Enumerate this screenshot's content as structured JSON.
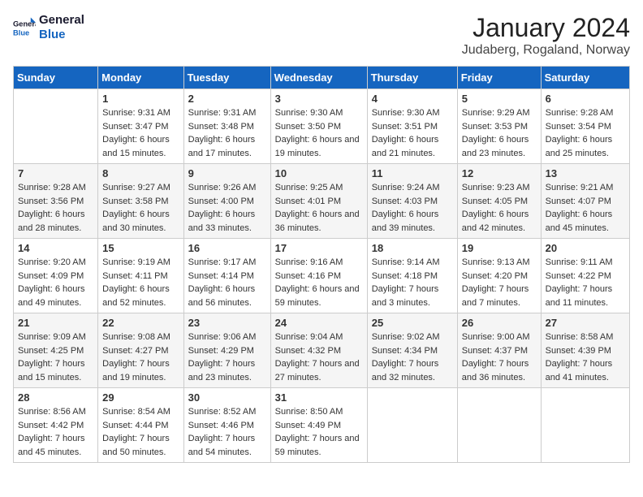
{
  "logo": {
    "line1": "General",
    "line2": "Blue"
  },
  "title": "January 2024",
  "location": "Judaberg, Rogaland, Norway",
  "days_of_week": [
    "Sunday",
    "Monday",
    "Tuesday",
    "Wednesday",
    "Thursday",
    "Friday",
    "Saturday"
  ],
  "weeks": [
    [
      {
        "day": "",
        "sunrise": "",
        "sunset": "",
        "daylight": ""
      },
      {
        "day": "1",
        "sunrise": "Sunrise: 9:31 AM",
        "sunset": "Sunset: 3:47 PM",
        "daylight": "Daylight: 6 hours and 15 minutes."
      },
      {
        "day": "2",
        "sunrise": "Sunrise: 9:31 AM",
        "sunset": "Sunset: 3:48 PM",
        "daylight": "Daylight: 6 hours and 17 minutes."
      },
      {
        "day": "3",
        "sunrise": "Sunrise: 9:30 AM",
        "sunset": "Sunset: 3:50 PM",
        "daylight": "Daylight: 6 hours and 19 minutes."
      },
      {
        "day": "4",
        "sunrise": "Sunrise: 9:30 AM",
        "sunset": "Sunset: 3:51 PM",
        "daylight": "Daylight: 6 hours and 21 minutes."
      },
      {
        "day": "5",
        "sunrise": "Sunrise: 9:29 AM",
        "sunset": "Sunset: 3:53 PM",
        "daylight": "Daylight: 6 hours and 23 minutes."
      },
      {
        "day": "6",
        "sunrise": "Sunrise: 9:28 AM",
        "sunset": "Sunset: 3:54 PM",
        "daylight": "Daylight: 6 hours and 25 minutes."
      }
    ],
    [
      {
        "day": "7",
        "sunrise": "Sunrise: 9:28 AM",
        "sunset": "Sunset: 3:56 PM",
        "daylight": "Daylight: 6 hours and 28 minutes."
      },
      {
        "day": "8",
        "sunrise": "Sunrise: 9:27 AM",
        "sunset": "Sunset: 3:58 PM",
        "daylight": "Daylight: 6 hours and 30 minutes."
      },
      {
        "day": "9",
        "sunrise": "Sunrise: 9:26 AM",
        "sunset": "Sunset: 4:00 PM",
        "daylight": "Daylight: 6 hours and 33 minutes."
      },
      {
        "day": "10",
        "sunrise": "Sunrise: 9:25 AM",
        "sunset": "Sunset: 4:01 PM",
        "daylight": "Daylight: 6 hours and 36 minutes."
      },
      {
        "day": "11",
        "sunrise": "Sunrise: 9:24 AM",
        "sunset": "Sunset: 4:03 PM",
        "daylight": "Daylight: 6 hours and 39 minutes."
      },
      {
        "day": "12",
        "sunrise": "Sunrise: 9:23 AM",
        "sunset": "Sunset: 4:05 PM",
        "daylight": "Daylight: 6 hours and 42 minutes."
      },
      {
        "day": "13",
        "sunrise": "Sunrise: 9:21 AM",
        "sunset": "Sunset: 4:07 PM",
        "daylight": "Daylight: 6 hours and 45 minutes."
      }
    ],
    [
      {
        "day": "14",
        "sunrise": "Sunrise: 9:20 AM",
        "sunset": "Sunset: 4:09 PM",
        "daylight": "Daylight: 6 hours and 49 minutes."
      },
      {
        "day": "15",
        "sunrise": "Sunrise: 9:19 AM",
        "sunset": "Sunset: 4:11 PM",
        "daylight": "Daylight: 6 hours and 52 minutes."
      },
      {
        "day": "16",
        "sunrise": "Sunrise: 9:17 AM",
        "sunset": "Sunset: 4:14 PM",
        "daylight": "Daylight: 6 hours and 56 minutes."
      },
      {
        "day": "17",
        "sunrise": "Sunrise: 9:16 AM",
        "sunset": "Sunset: 4:16 PM",
        "daylight": "Daylight: 6 hours and 59 minutes."
      },
      {
        "day": "18",
        "sunrise": "Sunrise: 9:14 AM",
        "sunset": "Sunset: 4:18 PM",
        "daylight": "Daylight: 7 hours and 3 minutes."
      },
      {
        "day": "19",
        "sunrise": "Sunrise: 9:13 AM",
        "sunset": "Sunset: 4:20 PM",
        "daylight": "Daylight: 7 hours and 7 minutes."
      },
      {
        "day": "20",
        "sunrise": "Sunrise: 9:11 AM",
        "sunset": "Sunset: 4:22 PM",
        "daylight": "Daylight: 7 hours and 11 minutes."
      }
    ],
    [
      {
        "day": "21",
        "sunrise": "Sunrise: 9:09 AM",
        "sunset": "Sunset: 4:25 PM",
        "daylight": "Daylight: 7 hours and 15 minutes."
      },
      {
        "day": "22",
        "sunrise": "Sunrise: 9:08 AM",
        "sunset": "Sunset: 4:27 PM",
        "daylight": "Daylight: 7 hours and 19 minutes."
      },
      {
        "day": "23",
        "sunrise": "Sunrise: 9:06 AM",
        "sunset": "Sunset: 4:29 PM",
        "daylight": "Daylight: 7 hours and 23 minutes."
      },
      {
        "day": "24",
        "sunrise": "Sunrise: 9:04 AM",
        "sunset": "Sunset: 4:32 PM",
        "daylight": "Daylight: 7 hours and 27 minutes."
      },
      {
        "day": "25",
        "sunrise": "Sunrise: 9:02 AM",
        "sunset": "Sunset: 4:34 PM",
        "daylight": "Daylight: 7 hours and 32 minutes."
      },
      {
        "day": "26",
        "sunrise": "Sunrise: 9:00 AM",
        "sunset": "Sunset: 4:37 PM",
        "daylight": "Daylight: 7 hours and 36 minutes."
      },
      {
        "day": "27",
        "sunrise": "Sunrise: 8:58 AM",
        "sunset": "Sunset: 4:39 PM",
        "daylight": "Daylight: 7 hours and 41 minutes."
      }
    ],
    [
      {
        "day": "28",
        "sunrise": "Sunrise: 8:56 AM",
        "sunset": "Sunset: 4:42 PM",
        "daylight": "Daylight: 7 hours and 45 minutes."
      },
      {
        "day": "29",
        "sunrise": "Sunrise: 8:54 AM",
        "sunset": "Sunset: 4:44 PM",
        "daylight": "Daylight: 7 hours and 50 minutes."
      },
      {
        "day": "30",
        "sunrise": "Sunrise: 8:52 AM",
        "sunset": "Sunset: 4:46 PM",
        "daylight": "Daylight: 7 hours and 54 minutes."
      },
      {
        "day": "31",
        "sunrise": "Sunrise: 8:50 AM",
        "sunset": "Sunset: 4:49 PM",
        "daylight": "Daylight: 7 hours and 59 minutes."
      },
      {
        "day": "",
        "sunrise": "",
        "sunset": "",
        "daylight": ""
      },
      {
        "day": "",
        "sunrise": "",
        "sunset": "",
        "daylight": ""
      },
      {
        "day": "",
        "sunrise": "",
        "sunset": "",
        "daylight": ""
      }
    ]
  ]
}
